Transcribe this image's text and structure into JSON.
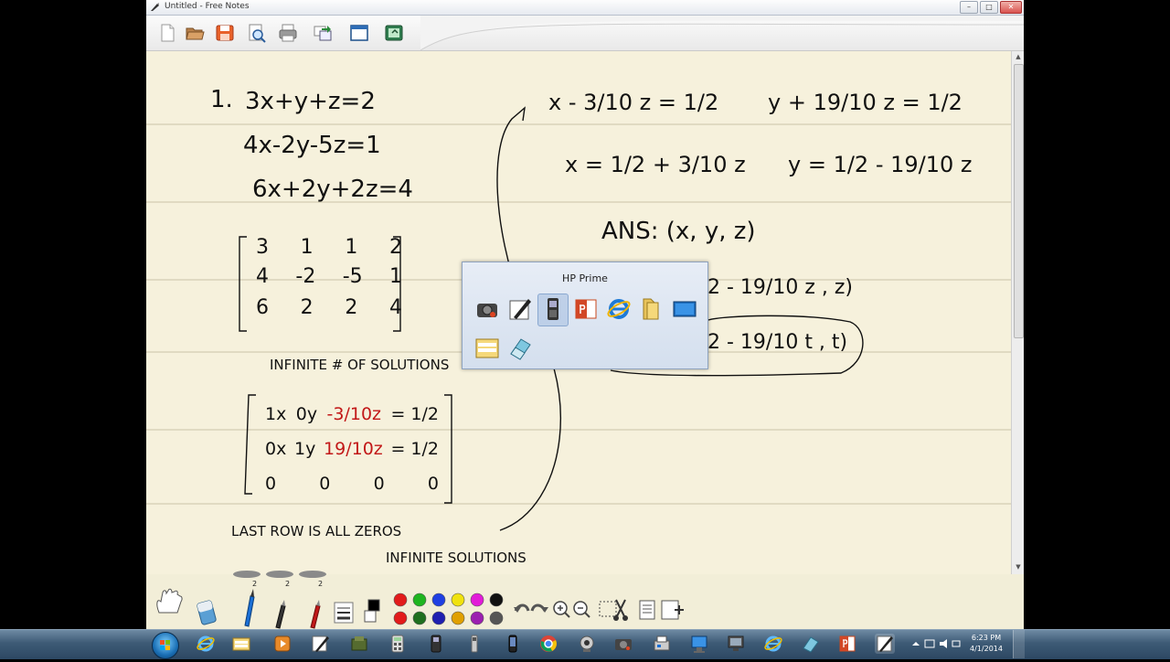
{
  "window": {
    "title": "Untitled - Free Notes"
  },
  "window_buttons": [
    "–",
    "□",
    "✕"
  ],
  "toolbar_icons": [
    "new-file-icon",
    "open-folder-icon",
    "save-icon",
    "print-preview-icon",
    "print-icon",
    "export-icon",
    "window-icon",
    "screen-capture-icon"
  ],
  "notes": {
    "problem_number": "1.",
    "eq1": "3x+y+z=2",
    "eq2": "4x-2y-5z=1",
    "eq3": "6x+2y+2z=4",
    "matrix1": [
      [
        "3",
        "1",
        "1",
        "2"
      ],
      [
        "4",
        "-2",
        "-5",
        "1"
      ],
      [
        "6",
        "2",
        "2",
        "4"
      ]
    ],
    "infinite_note": "INFINITE # OF SOLUTIONS",
    "matrix2_rows": [
      [
        "1x",
        "0y",
        "-3/10z",
        "= 1/2"
      ],
      [
        "0x",
        "1y",
        "19/10z",
        "= 1/2"
      ],
      [
        "0",
        "0",
        "0",
        "0"
      ]
    ],
    "last_row_note": "LAST ROW IS ALL ZEROS",
    "infinite_solutions": "INFINITE SOLUTIONS",
    "right_eq1a": "x - 3/10 z = 1/2",
    "right_eq1b": "y + 19/10 z = 1/2",
    "right_eq2a": "x = 1/2 + 3/10 z",
    "right_eq2b": "y = 1/2 - 19/10 z",
    "ans_label": "ANS: (x, y, z)",
    "ans_row1": "2 - 19/10 z , z)",
    "ans_row2": "2 - 19/10 t , t)"
  },
  "popup": {
    "title": "HP Prime",
    "icons": [
      "camera-app-icon",
      "pen-app-icon",
      "hp-prime-icon",
      "powerpoint-icon",
      "internet-explorer-icon",
      "folder-icon",
      "desktop-icon",
      "file-manager-icon",
      "eraser-app-icon"
    ]
  },
  "bottom_tools": {
    "pen_widths": [
      "2",
      "2",
      "2"
    ],
    "colors": [
      "#e21b1b",
      "#1fb51f",
      "#1f3fe2",
      "#f0e20e",
      "#e21bd8",
      "#111111",
      "#e21b1b",
      "#1f6f1f",
      "#1f1fb0",
      "#e0a000",
      "#9b1fb0",
      "#555555"
    ]
  },
  "taskbar": {
    "time": "6:23 PM",
    "date": "4/1/2014",
    "items": [
      "internet-explorer-icon",
      "windows-explorer-icon",
      "media-player-icon",
      "pen-icon",
      "tools-icon",
      "calculator-icon",
      "hp-prime-icon",
      "usb-device-icon",
      "phone-icon",
      "chrome-icon",
      "webcam-icon",
      "camera-icon",
      "fax-icon",
      "network-icon",
      "internet-explorer-icon",
      "eraser-icon",
      "powerpoint-icon",
      "free-notes-icon"
    ]
  }
}
